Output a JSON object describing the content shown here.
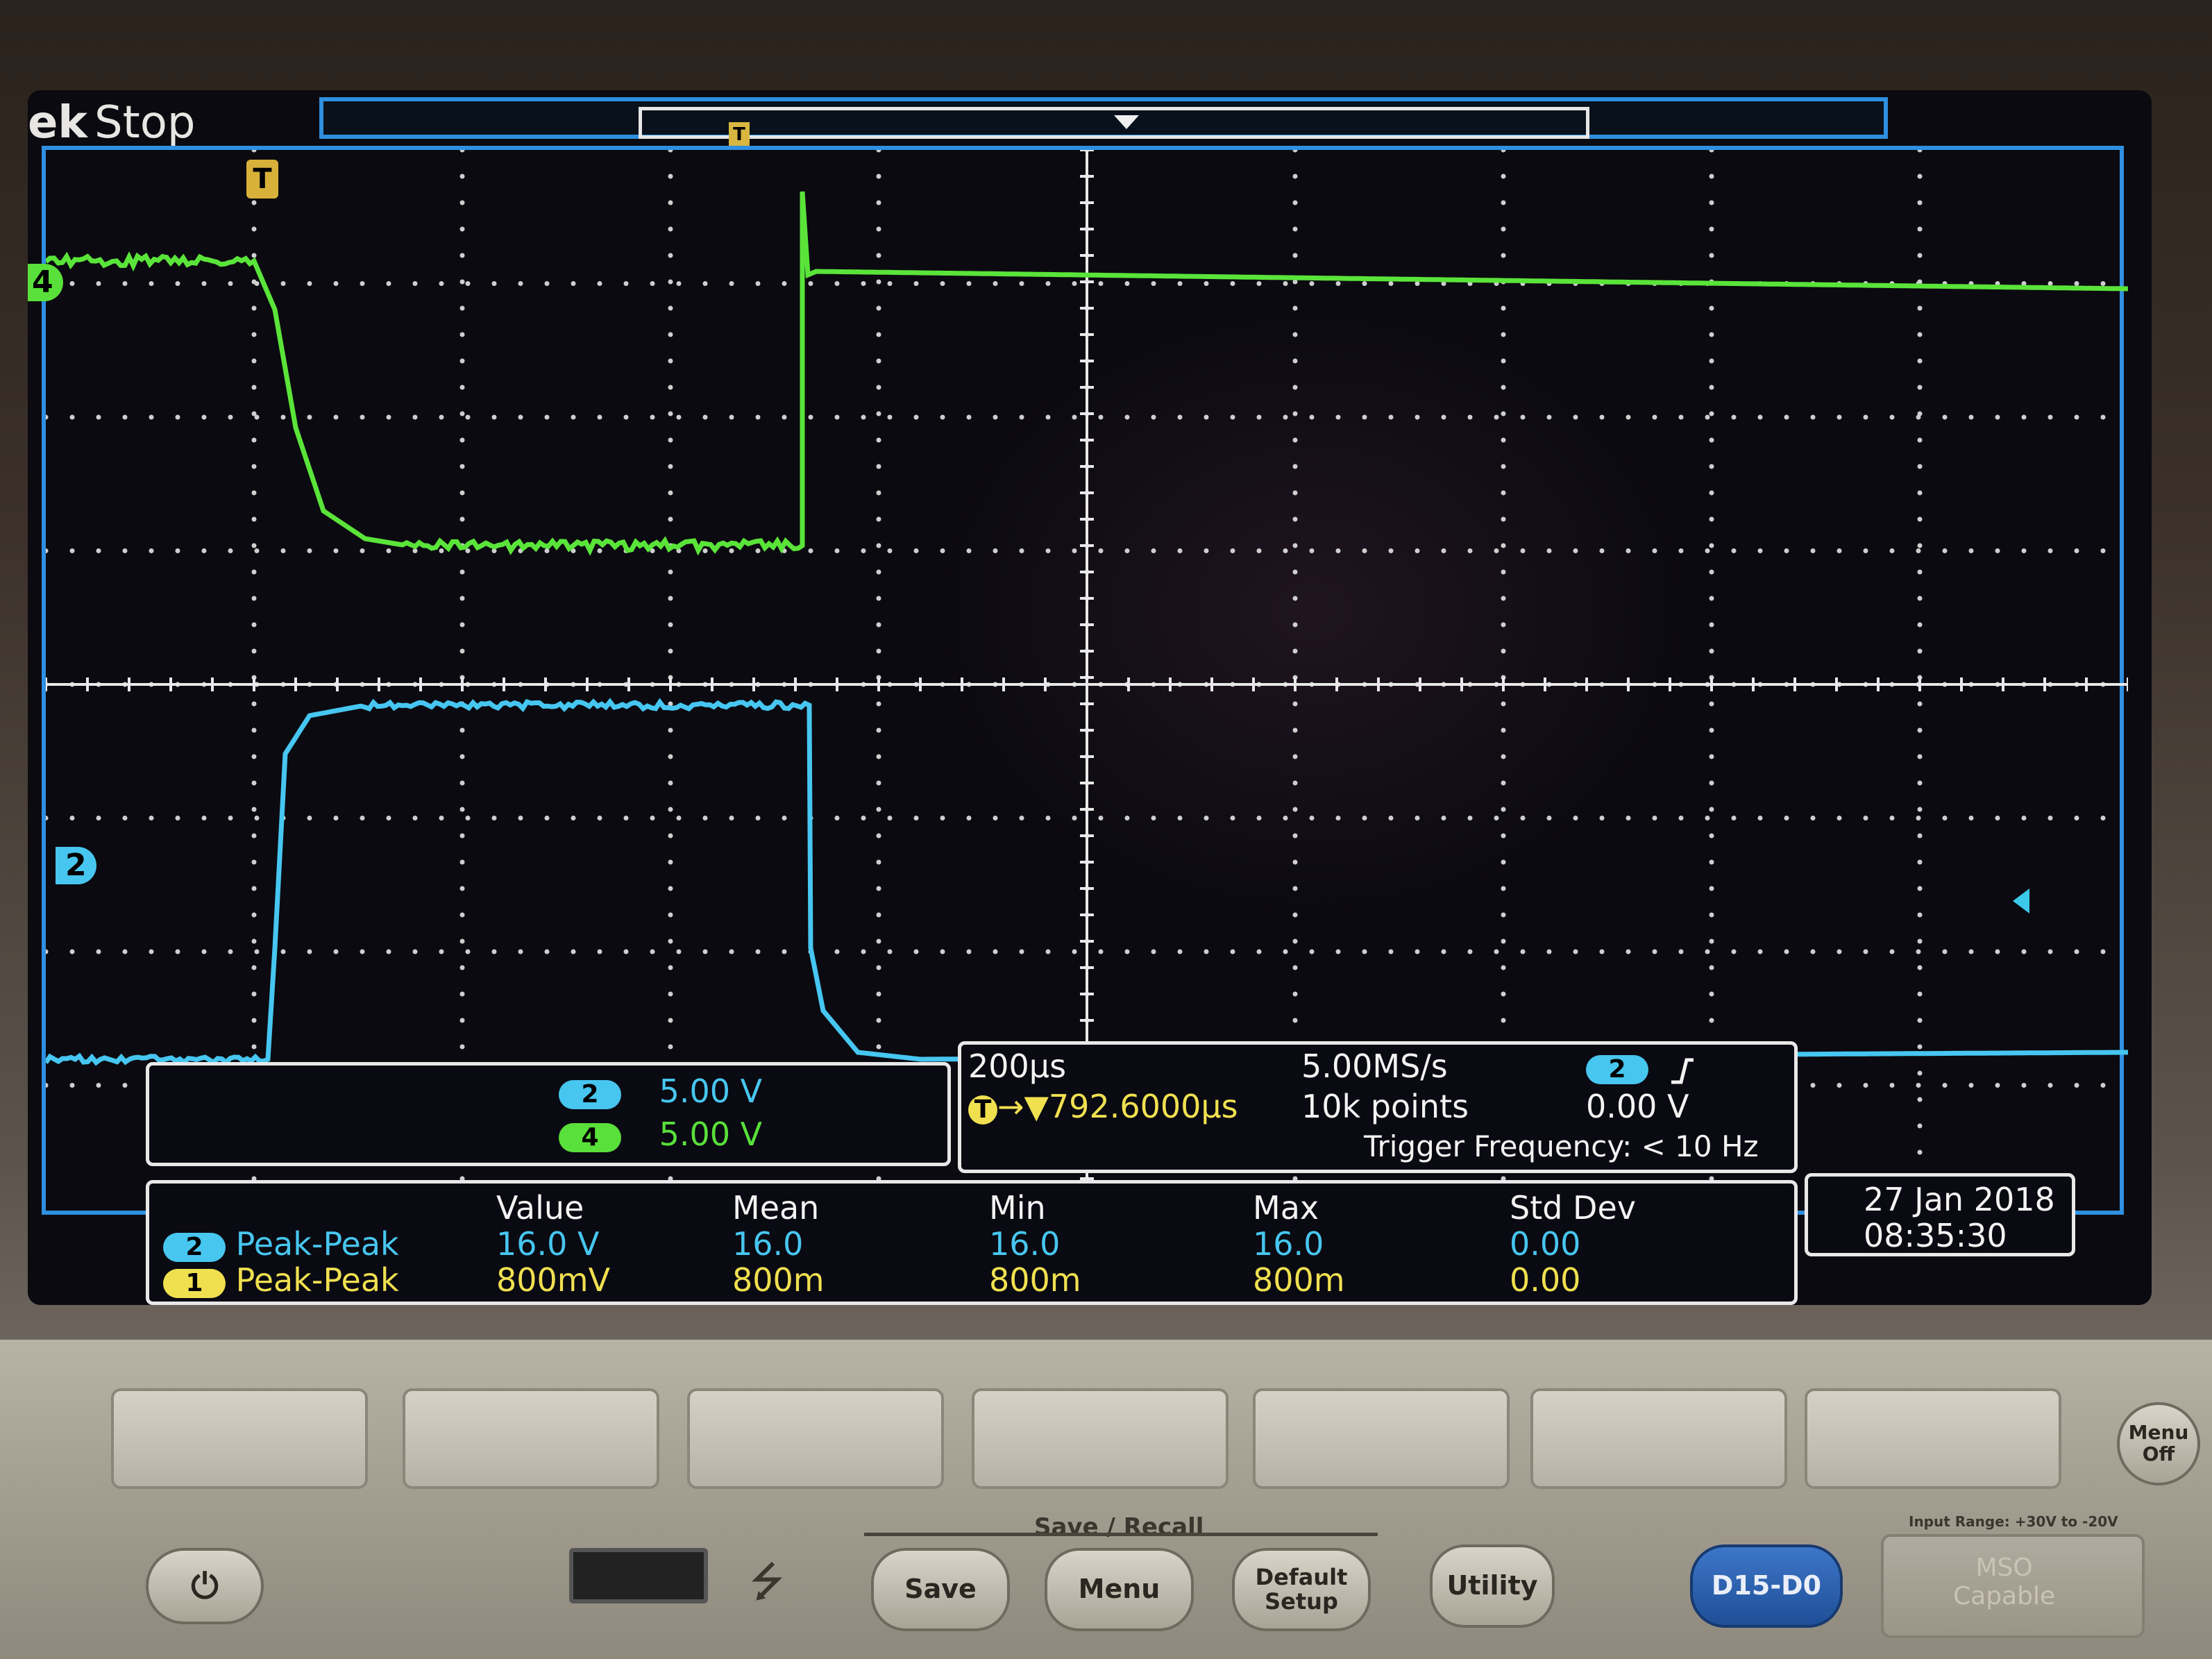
{
  "status": {
    "brand": "ek",
    "acq_state": "Stop"
  },
  "markers": {
    "trigger_T": "T",
    "ch4": "4",
    "ch2": "2"
  },
  "channel_scales": [
    {
      "channel": "2",
      "value": "5.00 V",
      "color": "#47c6ef"
    },
    {
      "channel": "4",
      "value": "5.00 V",
      "color": "#59e03a"
    }
  ],
  "horizontal": {
    "time_per_div": "200µs",
    "trigger_position": "→▼792.6000µs",
    "sample_rate": "5.00MS/s",
    "record_length": "10k points",
    "trigger_channel": "2",
    "trigger_slope_icon": "rising-edge-icon",
    "trigger_level": "0.00 V",
    "trigger_frequency": "Trigger Frequency: < 10 Hz"
  },
  "measurements": {
    "headers": [
      "Value",
      "Mean",
      "Min",
      "Max",
      "Std Dev"
    ],
    "rows": [
      {
        "channel": "2",
        "name": "Peak-Peak",
        "value": "16.0 V",
        "mean": "16.0",
        "min": "16.0",
        "max": "16.0",
        "std": "0.00",
        "color": "#47c6ef"
      },
      {
        "channel": "1",
        "name": "Peak-Peak",
        "value": "800mV",
        "mean": "800m",
        "min": "800m",
        "max": "800m",
        "std": "0.00",
        "color": "#f0e050"
      }
    ]
  },
  "datetime": {
    "date": "27 Jan  2018",
    "time": "08:35:30"
  },
  "front_panel": {
    "group_label": "Save / Recall",
    "buttons": {
      "save": "Save",
      "menu": "Menu",
      "default_setup": "Default\nSetup",
      "utility": "Utility",
      "digital": "D15-D0",
      "menu_off": "Menu\nOff"
    },
    "input_range": "Input Range: +30V to -20V",
    "msc_label": "MSO\nCapable"
  },
  "waveforms": [
    {
      "channel": "4",
      "color": "#5ae43a",
      "shape": "high-fall-low-spike-high"
    },
    {
      "channel": "2",
      "color": "#46c6f0",
      "shape": "low-rise-high-fall-low"
    }
  ]
}
